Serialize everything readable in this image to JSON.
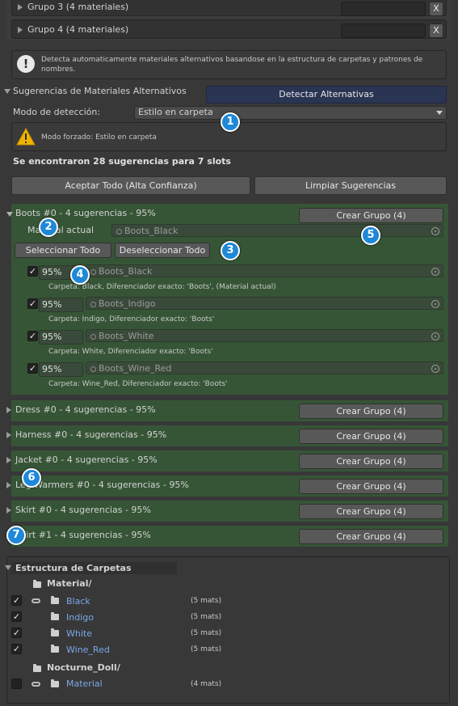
{
  "groups_top": [
    {
      "label": "Grupo 3 (4 materiales)",
      "remove_label": "X"
    },
    {
      "label": "Grupo 4 (4 materiales)",
      "remove_label": "X"
    }
  ],
  "info_message": "Detecta automaticamente materiales alternativos basandose en la estructura de carpetas y patrones de nombres.",
  "suggestions": {
    "header": "Sugerencias de Materiales Alternativos",
    "detect_button": "Detectar Alternativas",
    "mode_label": "Modo de detección:",
    "mode_value": "Estilo en carpeta",
    "warning": "Modo forzado: Estilo en carpeta",
    "summary": "Se encontraron 28 sugerencias para 7 slots",
    "accept_all": "Aceptar Todo (Alta Confianza)",
    "clear": "Limpiar Sugerencias"
  },
  "boots": {
    "title": "Boots #0 - 4 sugerencias - 95%",
    "create_group": "Crear Grupo (4)",
    "current_label": "Material actual",
    "current_value": "Boots_Black",
    "select_all": "Seleccionar Todo",
    "deselect_all": "Deseleccionar Todo",
    "items": [
      {
        "checked": "✓",
        "pct": "95%",
        "material": "Boots_Black",
        "detail": "Carpeta: Black, Diferenciador exacto: 'Boots', (Material actual)"
      },
      {
        "checked": "✓",
        "pct": "95%",
        "material": "Boots_Indigo",
        "detail": "Carpeta: Indigo, Diferenciador exacto: 'Boots'"
      },
      {
        "checked": "✓",
        "pct": "95%",
        "material": "Boots_White",
        "detail": "Carpeta: White, Diferenciador exacto: 'Boots'"
      },
      {
        "checked": "✓",
        "pct": "95%",
        "material": "Boots_Wine_Red",
        "detail": "Carpeta: Wine_Red, Diferenciador exacto: 'Boots'"
      }
    ]
  },
  "slots": [
    {
      "title": "Dress #0 - 4 sugerencias - 95%",
      "button": "Crear Grupo (4)"
    },
    {
      "title": "Harness #0 - 4 sugerencias - 95%",
      "button": "Crear Grupo (4)"
    },
    {
      "title": "Jacket #0 - 4 sugerencias - 95%",
      "button": "Crear Grupo (4)"
    },
    {
      "title": "Leg Warmers #0 - 4 sugerencias - 95%",
      "button": "Crear Grupo (4)"
    },
    {
      "title": "Skirt #0 - 4 sugerencias - 95%",
      "button": "Crear Grupo (4)"
    },
    {
      "title": "Skirt #1 - 4 sugerencias - 95%",
      "button": "Crear Grupo (4)"
    }
  ],
  "folders": {
    "header": "Estructura de Carpetas",
    "root1": "Material/",
    "root2": "Nocturne_Doll/",
    "items": [
      {
        "name": "Black",
        "count": "(5 mats)",
        "checked": "✓"
      },
      {
        "name": "Indigo",
        "count": "(5 mats)",
        "checked": "✓"
      },
      {
        "name": "White",
        "count": "(5 mats)",
        "checked": "✓"
      },
      {
        "name": "Wine_Red",
        "count": "(5 mats)",
        "checked": "✓"
      }
    ],
    "extra": {
      "name": "Material",
      "count": "(4 mats)",
      "checked": ""
    }
  },
  "callouts": [
    "1",
    "2",
    "3",
    "4",
    "5",
    "6",
    "7"
  ],
  "colors": {
    "accent_callout": "#1e88d9",
    "slot_green": "#365536",
    "detect_button": "#2a3554",
    "warning_yellow": "#f0b400"
  }
}
